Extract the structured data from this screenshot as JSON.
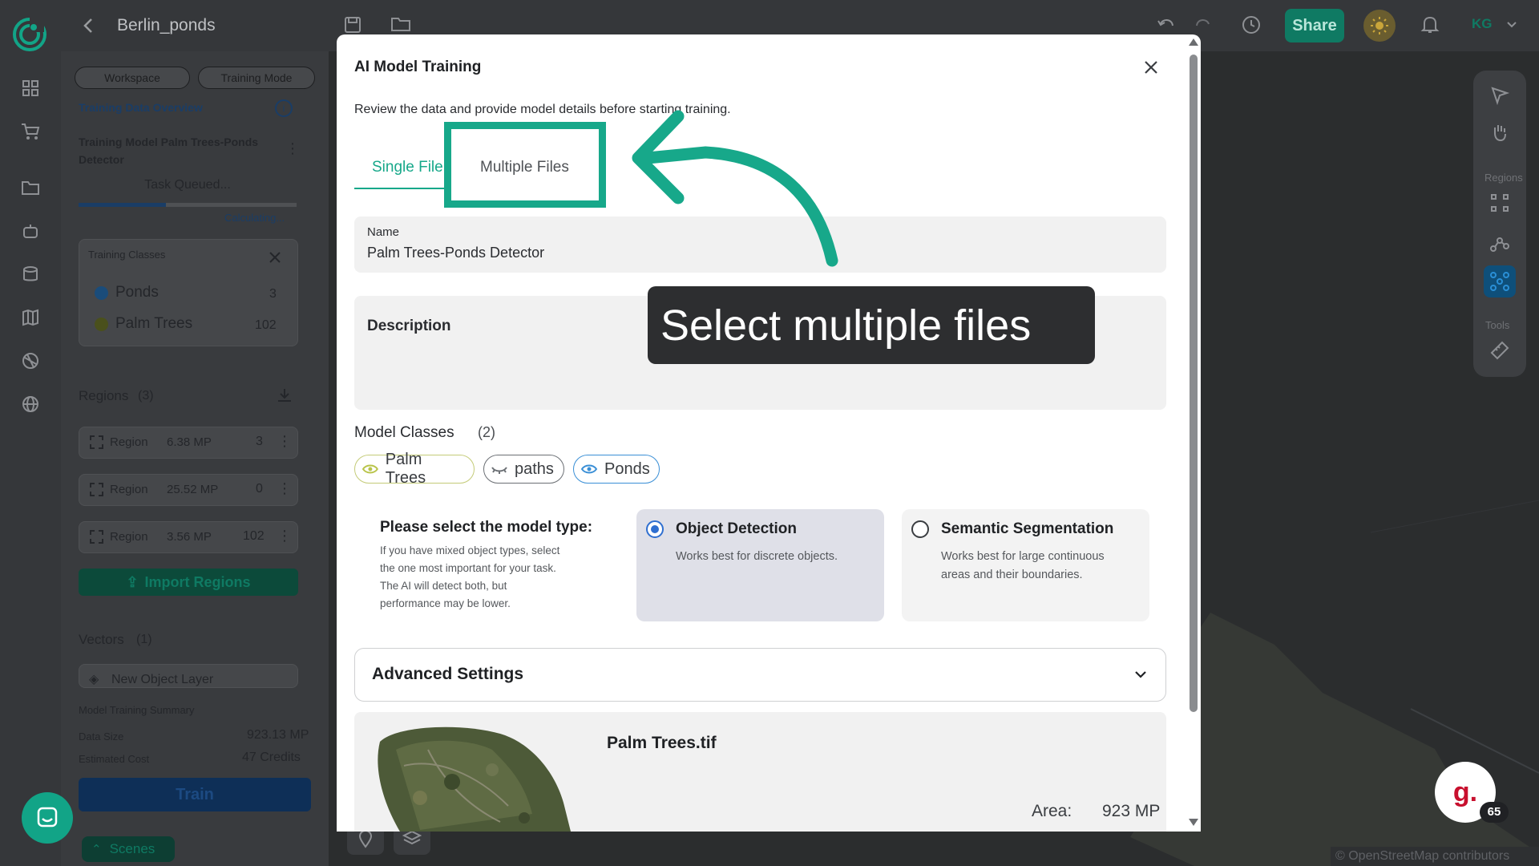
{
  "topbar": {
    "project_title": "Berlin_ponds",
    "share_label": "Share",
    "user_initials": "KG"
  },
  "left_panel": {
    "workspace_label": "Workspace",
    "training_mode_label": "Training Mode",
    "overview_title": "Training Data Overview",
    "model_title": "Training Model Palm Trees-Ponds Detector",
    "task_status": "Task Queued...",
    "calculating": "Calculating...",
    "progress_fraction": 0.4,
    "training_classes_title": "Training Classes",
    "classes": [
      {
        "name": "Ponds",
        "count": "3",
        "color": "#1f6fb8"
      },
      {
        "name": "Palm Trees",
        "count": "102",
        "color": "#6e7a16"
      }
    ],
    "regions_title": "Regions",
    "regions_count": "(3)",
    "regions": [
      {
        "label": "Region",
        "size": "6.38 MP",
        "count": "3"
      },
      {
        "label": "Region",
        "size": "25.52 MP",
        "count": "0"
      },
      {
        "label": "Region",
        "size": "3.56 MP",
        "count": "102"
      }
    ],
    "import_regions_label": "Import Regions",
    "vectors_title": "Vectors",
    "vectors_count": "(1)",
    "vector_item": "New Object Layer",
    "summary_title": "Model Training Summary",
    "data_size_label": "Data Size",
    "data_size_value": "923.13 MP",
    "cost_label": "Estimated Cost",
    "cost_value": "47 Credits",
    "train_label": "Train",
    "scenes_label": "Scenes"
  },
  "right_tools": {
    "regions_label": "Regions",
    "tools_label": "Tools"
  },
  "modal": {
    "title": "AI Model Training",
    "subtitle": "Review the data and provide model details before starting training.",
    "tabs": [
      {
        "label": "Single File",
        "active": true
      },
      {
        "label": "Multiple Files",
        "active": false
      }
    ],
    "name_label": "Name",
    "name_value": "Palm Trees-Ponds Detector",
    "description_label": "Description",
    "model_classes_label": "Model Classes",
    "model_classes_count": "(2)",
    "chips": [
      {
        "label": "Palm Trees",
        "icon": "eye-icon",
        "color": "#b9c44a"
      },
      {
        "label": "paths",
        "icon": "eye-closed-icon",
        "color": "#6b6f74"
      },
      {
        "label": "Ponds",
        "icon": "eye-icon",
        "color": "#3a8fd6"
      }
    ],
    "model_type_title": "Please select the model type:",
    "model_type_help": "If you have mixed object types, select the one most important for your task. The AI will detect both, but performance may be lower.",
    "options": [
      {
        "title": "Object Detection",
        "desc": "Works best for discrete objects.",
        "selected": true
      },
      {
        "title": "Semantic Segmentation",
        "desc": "Works best for large continuous areas and their boundaries.",
        "selected": false
      }
    ],
    "advanced_label": "Advanced Settings",
    "file_name": "Palm Trees.tif",
    "area_label": "Area:",
    "area_value": "923 MP"
  },
  "annotation": {
    "tooltip": "Select multiple files",
    "accent": "#17a88a"
  },
  "attribution": "© OpenStreetMap contributors",
  "badge": {
    "letter": "g.",
    "count": "65"
  }
}
